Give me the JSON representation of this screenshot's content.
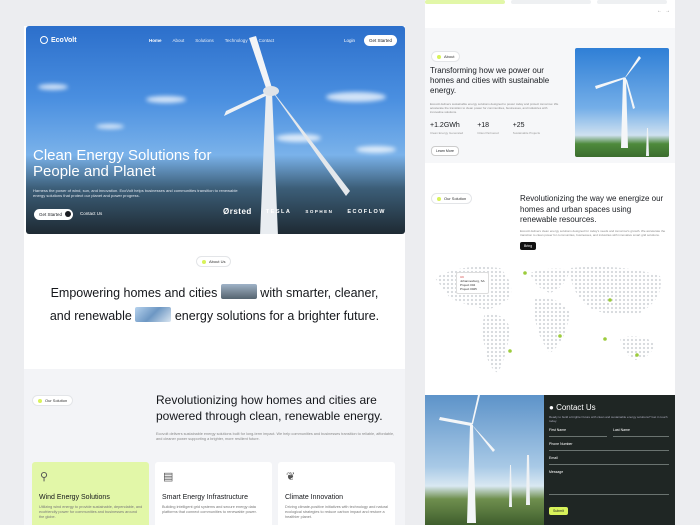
{
  "brand": "EcoVolt",
  "nav": {
    "links": [
      "Home",
      "About",
      "Solutions",
      "Technology",
      "Contact"
    ],
    "login": "Login",
    "cta": "Get Started"
  },
  "hero": {
    "title": "Clean Energy Solutions for People and Planet",
    "description": "Harness the power of wind, sun, and innovation. EcoVolt helps businesses and communities transition to renewable energy solutions that protect our planet and power progress.",
    "primary_button": "Get Started",
    "secondary_button": "Contact Us",
    "partner_logos": [
      "Ørsted",
      "TESLA",
      "SOPHEN",
      "ECOFLOW"
    ]
  },
  "about": {
    "pill": "About Us",
    "text_1": "Empowering homes and cities",
    "text_2": "with smarter, cleaner, and renewable",
    "text_3": "energy solutions for a brighter future."
  },
  "solution": {
    "pill": "Our Solution",
    "title": "Revolutionizing how homes and cities are powered through clean, renewable energy.",
    "description": "Ecovolt delivers sustainable energy solutions built for long-term impact. We help communities and businesses transition to reliable, affordable, and cleaner power supporting a brighter, more resilient future.",
    "cards": [
      {
        "icon": "wind-icon",
        "title": "Wind Energy Solutions",
        "description": "Utilizing wind energy to provide sustainable, dependable, and ecofriendly power for communities and businesses around the globe."
      },
      {
        "icon": "building-icon",
        "title": "Smart Energy Infrastructure",
        "description": "Building intelligent grid systems and secure energy data platforms that connect communities to renewable power."
      },
      {
        "icon": "leaf-icon",
        "title": "Climate Innovation",
        "description": "Driving climate-positive initiatives with technology and natural ecological strategies to reduce carbon impact and restore a healthier planet."
      }
    ]
  },
  "right": {
    "about_pill": "About",
    "about_title": "Transforming how we power our homes and cities with sustainable energy.",
    "about_desc": "Ecovolt delivers sustainable energy solutions designed to power today and protect tomorrow. We accelerate the transition to clean power for communities, businesses, and industries with innovative solutions.",
    "stats": [
      {
        "value": "+1.2GWh",
        "label": "Clean Energy Generated"
      },
      {
        "value": "+18",
        "label": "Cities Partnered"
      },
      {
        "value": "+25",
        "label": "Sustainable Projects"
      }
    ],
    "learn_more": "Learn More",
    "sol_pill": "Our Solution",
    "sol_title": "Revolutionizing the way we energize our homes and urban spaces using renewable resources.",
    "sol_desc": "Ecovolt delivers clean energy solutions designed for today's needs and tomorrow's growth. We accelerate the transition to clean power for communities, businesses, and industries with innovative smart grid solutions.",
    "sol_button": "Bring",
    "map_tooltip": [
      "UK",
      "Johannesburg, SA",
      "Project 004",
      "Project 0025"
    ],
    "contact_title": "Contact Us",
    "contact_desc": "Ready to build a brighter future with clean and sustainable energy solutions? Get in touch today.",
    "fields": [
      "First Name",
      "Last Name",
      "Phone Number",
      "Email",
      "Message"
    ],
    "send": "Submit"
  }
}
